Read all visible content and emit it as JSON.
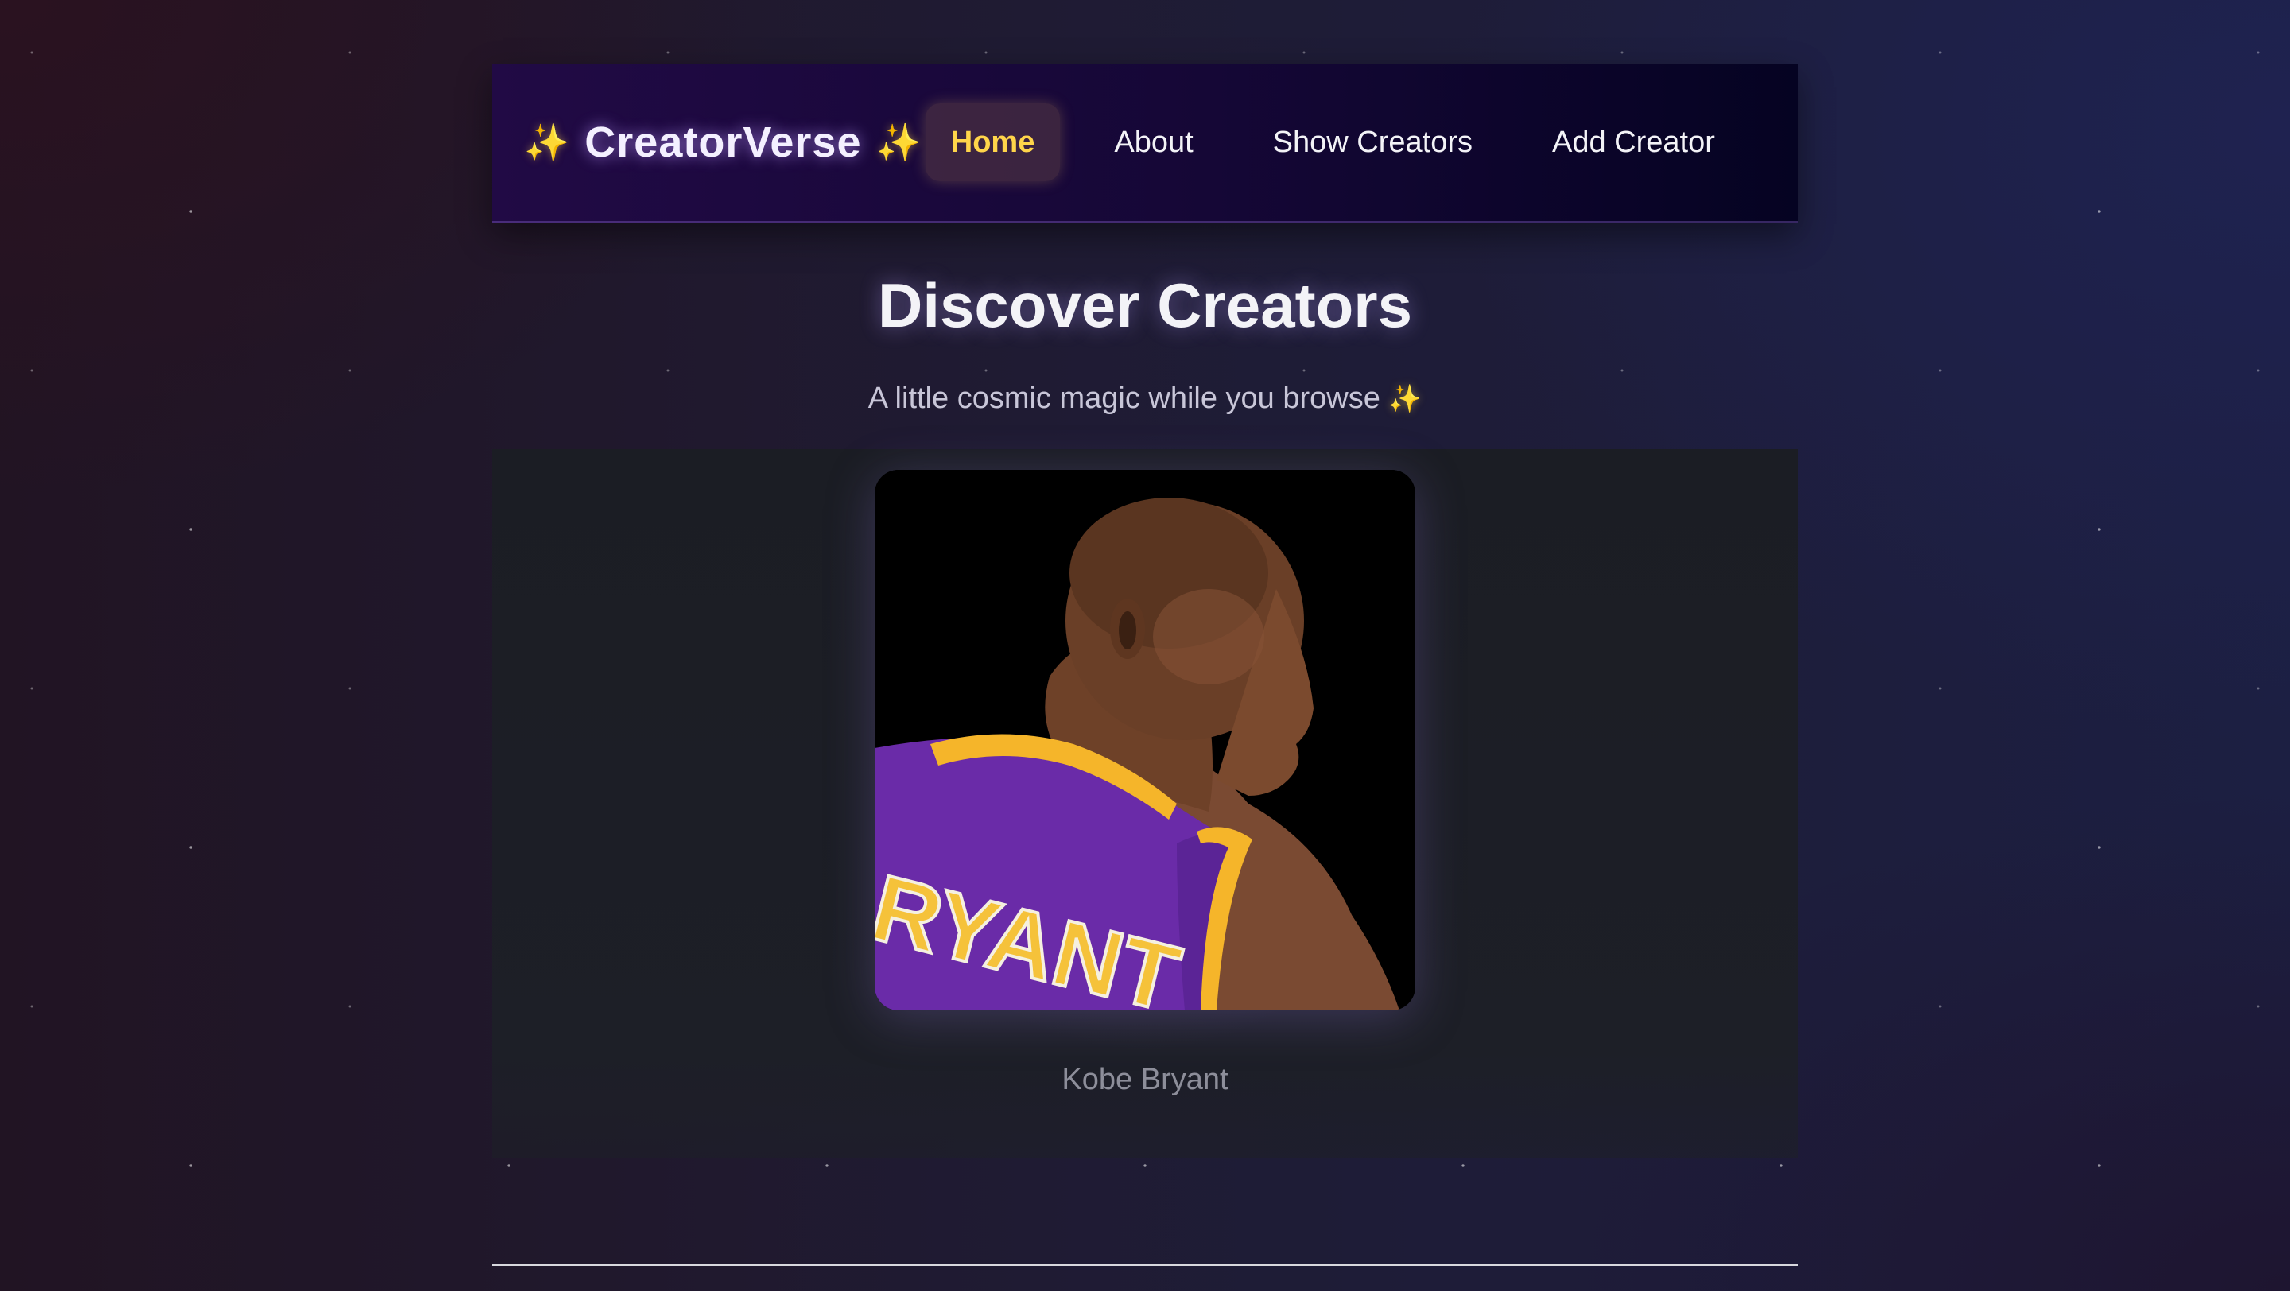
{
  "nav": {
    "brand": "CreatorVerse",
    "brand_sparkle": "✨",
    "links": [
      {
        "label": "Home",
        "active": true
      },
      {
        "label": "About",
        "active": false
      },
      {
        "label": "Show Creators",
        "active": false
      },
      {
        "label": "Add Creator",
        "active": false
      }
    ]
  },
  "hero": {
    "title": "Discover Creators",
    "subtitle": "A little cosmic magic while you browse",
    "subtitle_sparkle": "✨"
  },
  "featured_creator": {
    "name": "Kobe Bryant",
    "jersey_text": "RYANT"
  },
  "colors": {
    "accent": "#ffd54a",
    "nav_bg_start": "#210a45",
    "nav_bg_end": "#050322",
    "jersey_purple": "#6a2ba8",
    "jersey_gold": "#f5b52a"
  }
}
